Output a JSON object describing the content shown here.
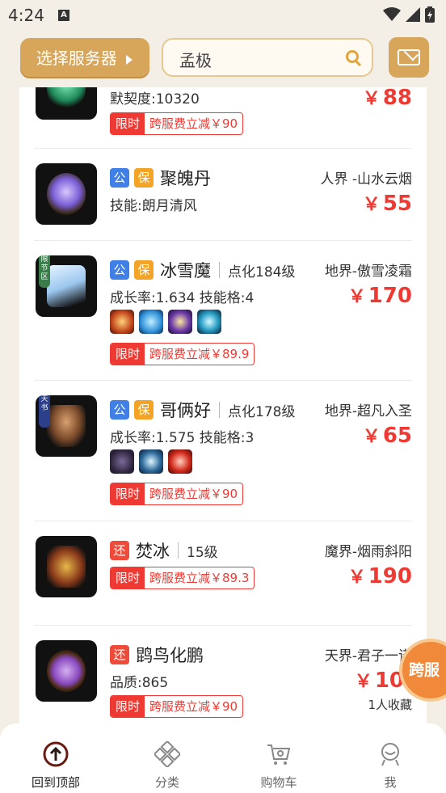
{
  "status_bar": {
    "time": "4:24",
    "notification_glyph": "A"
  },
  "header": {
    "server_button_label": "选择服务器",
    "search_value": "孟极"
  },
  "items": [
    {
      "sub": "默契度:10320",
      "price": "88",
      "promo_limit": "限时",
      "promo_text": "跨服费立减￥90"
    },
    {
      "tags": [
        "公",
        "保"
      ],
      "name": "聚魄丹",
      "server": "人界 -山水云烟",
      "sub": "技能:朗月清风",
      "price": "55"
    },
    {
      "tags": [
        "公",
        "保"
      ],
      "name": "冰雪魔",
      "level": "点化184级",
      "server": "地界-傲雪凌霜",
      "sub": "成长率:1.634 技能格:4",
      "price": "170",
      "ribbon": "限节区",
      "promo_limit": "限时",
      "promo_text": "跨服费立减￥89.9"
    },
    {
      "tags": [
        "公",
        "保"
      ],
      "name": "哥俩好",
      "level": "点化178级",
      "server": "地界-超凡入圣",
      "sub": "成长率:1.575 技能格:3",
      "price": "65",
      "ribbon": "天书",
      "promo_limit": "限时",
      "promo_text": "跨服费立减￥90"
    },
    {
      "tags": [
        "还"
      ],
      "name": "焚冰",
      "level": "15级",
      "server": "魔界-烟雨斜阳",
      "price": "190",
      "promo_limit": "限时",
      "promo_text": "跨服费立减￥89.3"
    },
    {
      "tags": [
        "还"
      ],
      "name": "鹍鸟化鹏",
      "server": "天界-君子一诺",
      "sub": "品质:865",
      "price": "10",
      "favorites": "1人收藏",
      "promo_limit": "限时",
      "promo_text": "跨服费立减￥90"
    }
  ],
  "currency_symbol": "￥",
  "float_badge": "跨服",
  "tabbar": [
    {
      "label": "回到顶部",
      "icon": "arrow-up-circle-icon"
    },
    {
      "label": "分类",
      "icon": "category-diamond-icon"
    },
    {
      "label": "购物车",
      "icon": "cart-icon"
    },
    {
      "label": "我",
      "icon": "user-icon"
    }
  ],
  "colors": {
    "accent": "#d8a65a",
    "price": "#ef3a33",
    "tag_gong": "#3f7fe6",
    "tag_bao": "#f3a326",
    "tag_huan": "#ef4b3a"
  }
}
